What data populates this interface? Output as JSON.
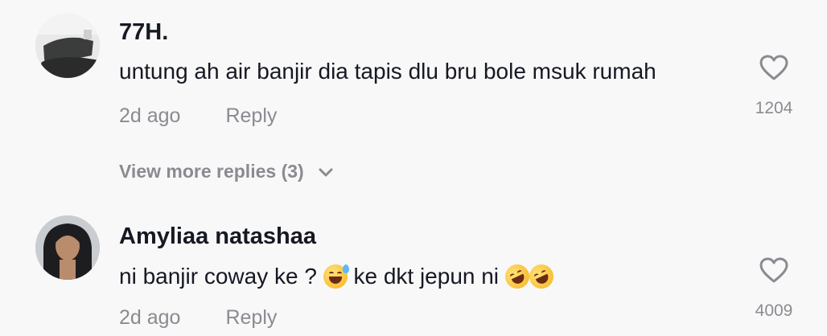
{
  "comments": [
    {
      "username": "77H.",
      "text": "untung ah air banjir dia tapis dlu bru bole msuk rumah",
      "time": "2d ago",
      "reply_label": "Reply",
      "likes": "1204",
      "avatar_icon": "user-avatar-photo"
    },
    {
      "username": "Amyliaa natashaa",
      "text_part1": "ni banjir coway ke ? ",
      "text_part2": " ke dkt jepun ni ",
      "emoji1": "😅",
      "emoji2": "🤣🤣",
      "time": "2d ago",
      "reply_label": "Reply",
      "likes": "4009",
      "avatar_icon": "user-avatar-photo"
    }
  ],
  "view_more": "View more replies (3)",
  "icons": {
    "like": "heart-outline-icon",
    "expand": "chevron-down-icon"
  },
  "colors": {
    "background": "#f8f8f8",
    "primary_text": "#161823",
    "secondary_text": "#8a8b91"
  }
}
